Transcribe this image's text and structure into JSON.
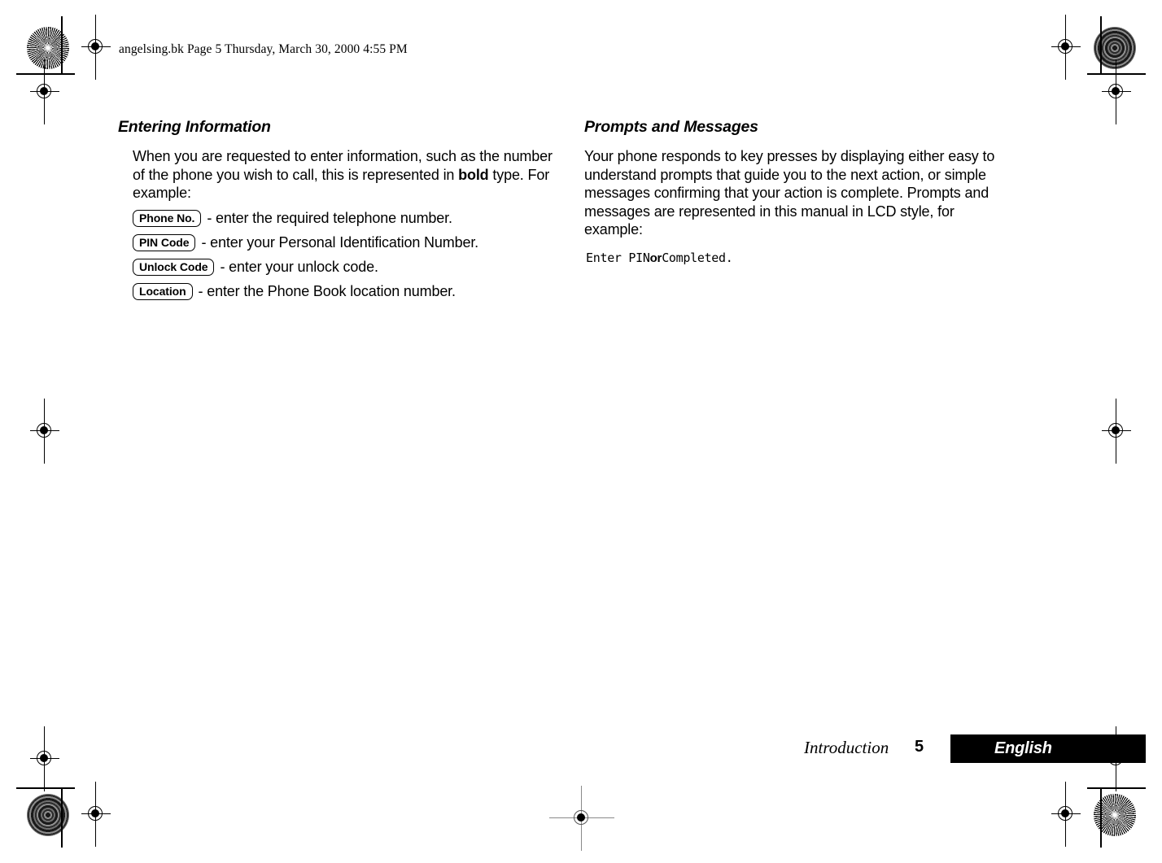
{
  "page": {
    "file_header": "angelsing.bk  Page 5  Thursday, March 30, 2000  4:55 PM",
    "background_color": "#ffffff",
    "text_color": "#000000"
  },
  "left_column": {
    "heading": "Entering Information",
    "intro_part1": "When you are requested to enter information, such as the number of the phone you wish to call, this is represented in ",
    "intro_bold": "bold",
    "intro_part2": " type. For example:",
    "key_items": [
      {
        "box_label": "Phone No.",
        "description": "- enter the required telephone number."
      },
      {
        "box_label": "PIN Code",
        "description": "- enter your Personal Identification Number."
      },
      {
        "box_label": "Unlock Code",
        "description": "- enter your unlock code."
      },
      {
        "box_label": "Location",
        "description": "- enter the Phone Book location number."
      }
    ]
  },
  "right_column": {
    "heading": "Prompts and Messages",
    "body": "Your phone responds to key presses by displaying either easy to understand prompts that guide you to the next action, or simple messages confirming that your action is complete. Prompts and messages are represented in this manual in LCD style, for example:",
    "lcd_example": {
      "first": "Enter PIN",
      "conjunction": "or",
      "second": "Completed."
    }
  },
  "footer": {
    "section": "Introduction",
    "page_number": "5",
    "language": "English",
    "language_bar_color": "#000000"
  }
}
